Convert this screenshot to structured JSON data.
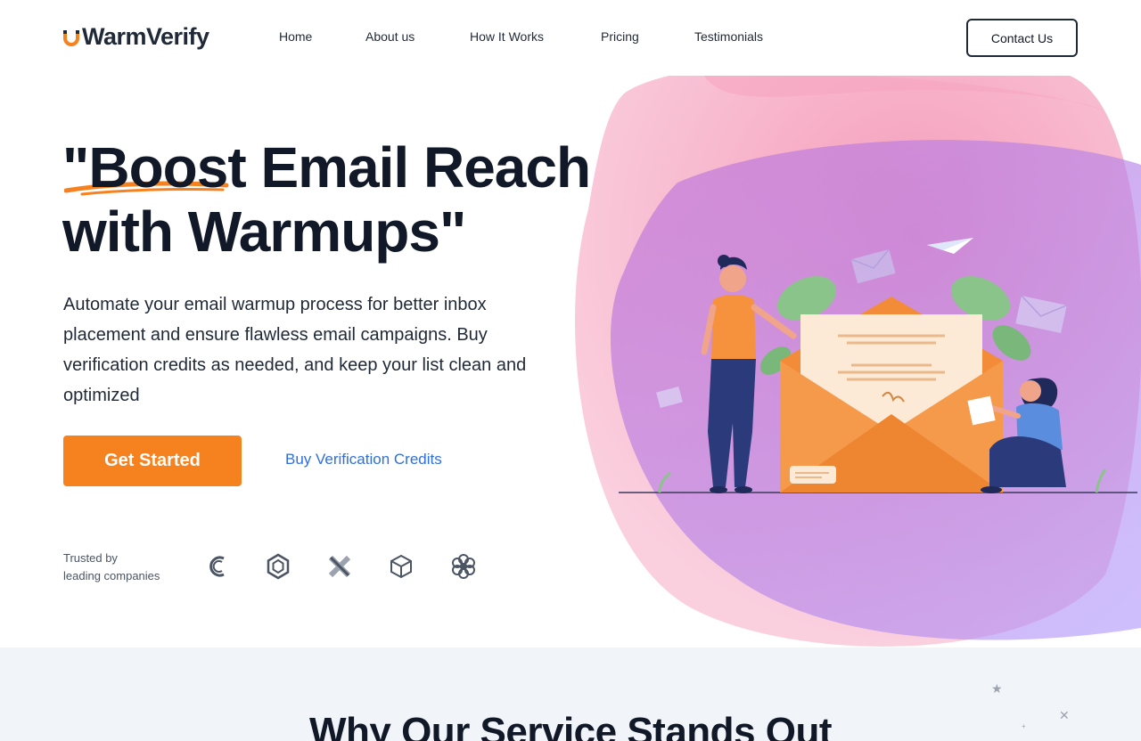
{
  "brand": {
    "name": "WarmVerify",
    "accent": "#f6821f",
    "text": "#1f2937"
  },
  "nav": {
    "items": [
      {
        "label": "Home"
      },
      {
        "label": "About us"
      },
      {
        "label": "How It Works"
      },
      {
        "label": "Pricing"
      },
      {
        "label": "Testimonials"
      }
    ],
    "contact_label": "Contact Us"
  },
  "hero": {
    "title_quote_open": "\"",
    "title_highlight": "Boost",
    "title_rest_line1": " Email Reach",
    "title_line2": "with Warmups\"",
    "description": "Automate your email warmup process for better inbox placement and ensure flawless email campaigns. Buy verification credits as needed, and keep your list clean and optimized",
    "cta_primary": "Get Started",
    "cta_secondary": "Buy Verification Credits",
    "illustration_icon": "email-warmup-illustration"
  },
  "trusted": {
    "line1": "Trusted by",
    "line2": "leading companies",
    "logos": [
      "company-c-icon",
      "company-hexagon-icon",
      "company-cross-icon",
      "company-cube-icon",
      "company-flower-icon"
    ]
  },
  "features": {
    "title": "Why Our Service Stands Out"
  }
}
